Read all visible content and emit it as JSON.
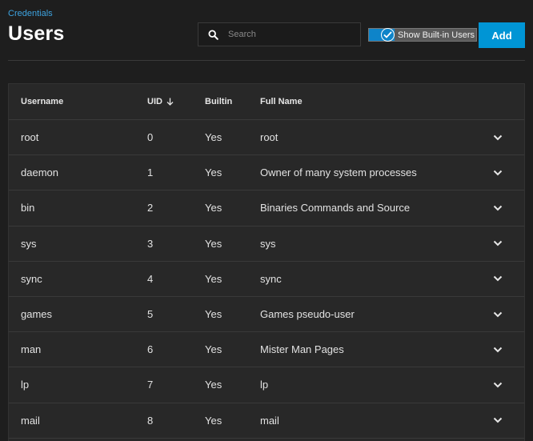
{
  "breadcrumb": "Credentials",
  "title": "Users",
  "search": {
    "placeholder": "Search",
    "value": ""
  },
  "toggle": {
    "label": "Show Built-in Users",
    "checked": true
  },
  "add_label": "Add",
  "table": {
    "columns": [
      "Username",
      "UID",
      "Builtin",
      "Full Name"
    ],
    "sort": {
      "column": "UID",
      "direction": "ascending"
    },
    "rows": [
      {
        "username": "root",
        "uid": "0",
        "builtin": "Yes",
        "full_name": "root"
      },
      {
        "username": "daemon",
        "uid": "1",
        "builtin": "Yes",
        "full_name": "Owner of many system processes"
      },
      {
        "username": "bin",
        "uid": "2",
        "builtin": "Yes",
        "full_name": "Binaries Commands and Source"
      },
      {
        "username": "sys",
        "uid": "3",
        "builtin": "Yes",
        "full_name": "sys"
      },
      {
        "username": "sync",
        "uid": "4",
        "builtin": "Yes",
        "full_name": "sync"
      },
      {
        "username": "games",
        "uid": "5",
        "builtin": "Yes",
        "full_name": "Games pseudo-user"
      },
      {
        "username": "man",
        "uid": "6",
        "builtin": "Yes",
        "full_name": "Mister Man Pages"
      },
      {
        "username": "lp",
        "uid": "7",
        "builtin": "Yes",
        "full_name": "lp"
      },
      {
        "username": "mail",
        "uid": "8",
        "builtin": "Yes",
        "full_name": "mail"
      }
    ]
  },
  "colors": {
    "background": "#1e1e1e",
    "card": "#282828",
    "accent": "#0095d5",
    "link": "#3da3e0"
  },
  "icons": {
    "search": "search-icon",
    "sort": "arrow-down-icon",
    "expand": "chevron-down-icon",
    "toggle": "check-icon"
  }
}
